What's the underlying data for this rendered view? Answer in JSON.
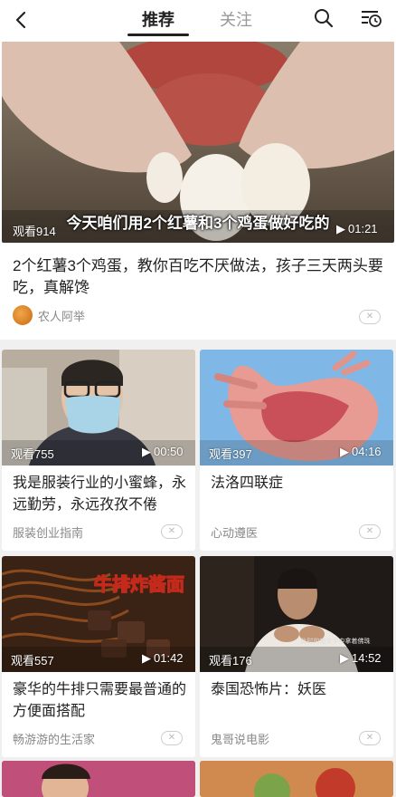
{
  "header": {
    "tabs": [
      {
        "label": "推荐",
        "active": true
      },
      {
        "label": "关注",
        "active": false
      }
    ],
    "icons": [
      "back-arrow-icon",
      "search-icon",
      "watch-history-icon"
    ]
  },
  "featured": {
    "views": "观看914",
    "duration": "01:21",
    "subtitle": "今天咱们用2个红薯和3个鸡蛋做好吃的",
    "title": "2个红薯3个鸡蛋，教你百吃不厌做法，孩子三天两头要吃，真解馋",
    "author": "农人阿举",
    "dismiss": "✕"
  },
  "cards": [
    {
      "views": "观看755",
      "duration": "00:50",
      "title": "我是服装行业的小蜜蜂，永远勤劳，永远孜孜不倦",
      "author": "服装创业指南",
      "dismiss": "✕"
    },
    {
      "views": "观看397",
      "duration": "04:16",
      "title": "法洛四联症",
      "author": "心动遵医",
      "dismiss": "✕"
    },
    {
      "views": "观看557",
      "duration": "01:42",
      "title": "豪华的牛排只需要最普通的方便面搭配",
      "author": "畅游游的生活家",
      "dismiss": "✕",
      "thumb_text": "牛排炸酱面"
    },
    {
      "views": "观看176",
      "duration": "14:52",
      "title": "泰国恐怖片：妖医",
      "author": "鬼哥说电影",
      "dismiss": "✕",
      "thumb_text": "此时的瑷文手中拿着佛珠"
    }
  ],
  "colors": {
    "accent_text": "#222222",
    "muted": "#888888",
    "background": "#f0f0f0"
  }
}
